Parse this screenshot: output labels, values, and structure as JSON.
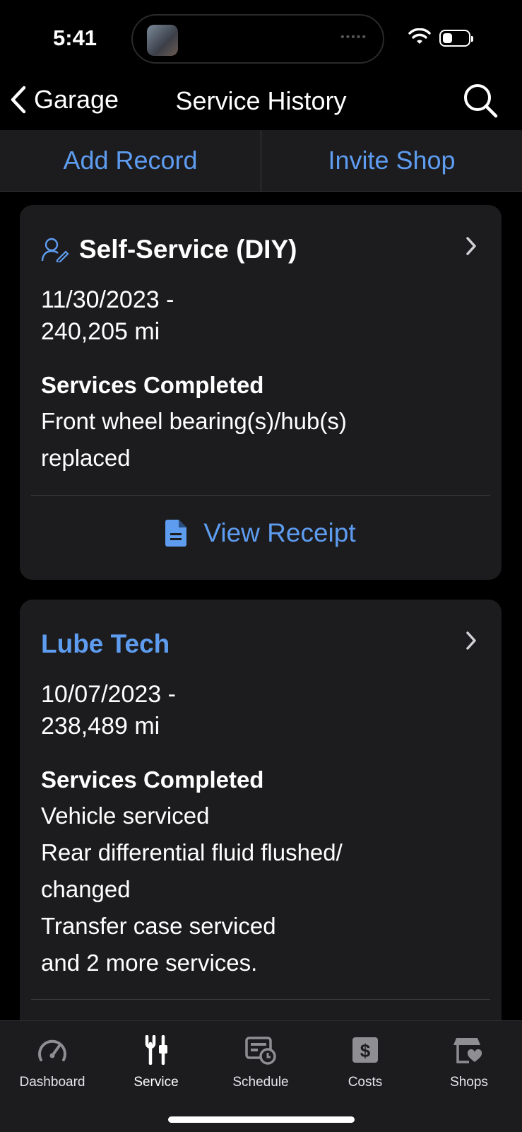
{
  "status": {
    "time": "5:41"
  },
  "nav": {
    "back_label": "Garage",
    "title": "Service History"
  },
  "actions": {
    "add_record": "Add Record",
    "invite_shop": "Invite Shop"
  },
  "records": [
    {
      "provider": "Self-Service (DIY)",
      "date_line": "11/30/2023 -",
      "mileage": "240,205 mi",
      "services_title": "Services Completed",
      "services": [
        "Front wheel bearing(s)/hub(s)",
        "replaced"
      ],
      "receipt_label": "View Receipt"
    },
    {
      "provider": "Lube Tech",
      "date_line": "10/07/2023 -",
      "mileage": "238,489 mi",
      "services_title": "Services Completed",
      "services": [
        "Vehicle serviced",
        "Rear differential fluid flushed/",
        "changed",
        "Transfer case serviced",
        "and 2 more services."
      ]
    }
  ],
  "tabs": [
    {
      "label": "Dashboard",
      "icon": "speedometer-icon"
    },
    {
      "label": "Service",
      "icon": "tools-icon"
    },
    {
      "label": "Schedule",
      "icon": "schedule-icon"
    },
    {
      "label": "Costs",
      "icon": "dollar-icon"
    },
    {
      "label": "Shops",
      "icon": "shop-heart-icon"
    }
  ],
  "colors": {
    "accent": "#5e9cf0",
    "card": "#1c1c1e",
    "background": "#000000"
  }
}
